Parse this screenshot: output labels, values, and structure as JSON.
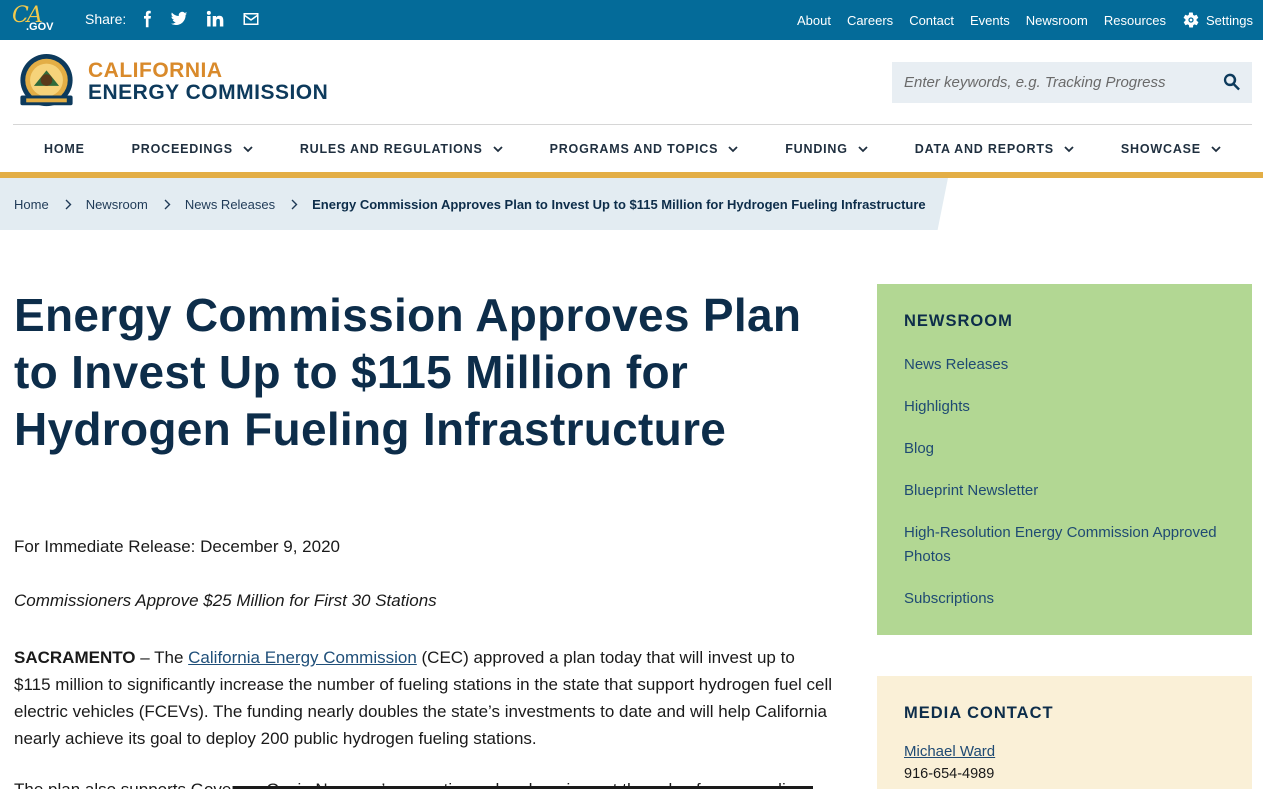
{
  "utility_bar": {
    "ca_logo_text": "CA",
    "gov_text": ".GOV",
    "share_label": "Share:",
    "share_icons": [
      "facebook-icon",
      "twitter-icon",
      "linkedin-icon",
      "email-icon"
    ],
    "links": [
      "About",
      "Careers",
      "Contact",
      "Events",
      "Newsroom",
      "Resources"
    ],
    "settings_label": "Settings"
  },
  "brand": {
    "line1": "CALIFORNIA",
    "line2": "ENERGY COMMISSION"
  },
  "search": {
    "placeholder": "Enter keywords, e.g. Tracking Progress"
  },
  "nav": {
    "items": [
      {
        "label": "HOME",
        "has_dropdown": false
      },
      {
        "label": "PROCEEDINGS",
        "has_dropdown": true
      },
      {
        "label": "RULES AND REGULATIONS",
        "has_dropdown": true
      },
      {
        "label": "PROGRAMS AND TOPICS",
        "has_dropdown": true
      },
      {
        "label": "FUNDING",
        "has_dropdown": true
      },
      {
        "label": "DATA AND REPORTS",
        "has_dropdown": true
      },
      {
        "label": "SHOWCASE",
        "has_dropdown": true
      }
    ]
  },
  "breadcrumb": {
    "items": [
      "Home",
      "Newsroom",
      "News Releases"
    ],
    "current": "Energy Commission Approves Plan to Invest Up to $115 Million for Hydrogen Fueling Infrastructure"
  },
  "article": {
    "title": "Energy Commission Approves Plan to Invest Up to $115 Million for Hydrogen Fueling Infrastructure",
    "release_line": "For Immediate Release: December 9, 2020",
    "subhead": "Commissioners Approve $25 Million for First 30 Stations",
    "para_lead": "SACRAMENTO",
    "para_dash": " – The ",
    "para_link": "California Energy Commission",
    "para_rest": " (CEC) approved a plan today that will invest up to $115 million to significantly increase the number of fueling stations in the state that support hydrogen fuel cell electric vehicles (FCEVs). The funding nearly doubles the state’s investments to date and will help California nearly achieve its goal to deploy 200 public hydrogen fueling stations.",
    "para2": "The plan also supports Governor Gavin Newsom’s executive order, dropping out the sale of new gasoline"
  },
  "sidebar": {
    "newsroom_heading": "NEWSROOM",
    "newsroom_links": [
      "News Releases",
      "Highlights",
      "Blog",
      "Blueprint Newsletter",
      "High-Resolution Energy Commission Approved Photos",
      "Subscriptions"
    ],
    "media_heading": "MEDIA CONTACT",
    "media_name": "Michael Ward",
    "media_phone": "916-654-4989"
  },
  "colors": {
    "utility_bar": "#046b99",
    "brand_orange": "#d98a2b",
    "brand_navy": "#0d3a5c",
    "nav_gold": "#e3ae45",
    "breadcrumb_bg": "#e3ecf2",
    "newsroom_bg": "#b2d793",
    "media_bg": "#faf0d7"
  }
}
